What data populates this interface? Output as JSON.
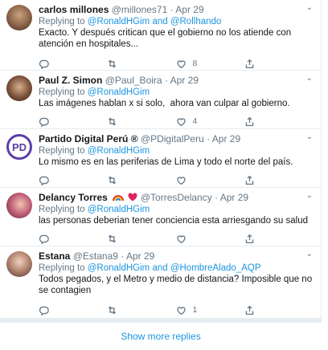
{
  "replies": [
    {
      "name": "carlos millones",
      "handle": "@millones71",
      "sep": "·",
      "date": "Apr 29",
      "replying_prefix": "Replying to",
      "replying_to": "@RonaldHGim and @Rollhando",
      "text": "Exacto. Y después critican que el gobierno no los atiende con atención en hospitales...",
      "reply_count": "",
      "retweet_count": "",
      "like_count": "8"
    },
    {
      "name": "Paul Z. Simon",
      "handle": "@Paul_Boira",
      "sep": "·",
      "date": "Apr 29",
      "replying_prefix": "Replying to",
      "replying_to": "@RonaldHGim",
      "text": "Las imágenes hablan x si solo,  ahora van culpar al gobierno.",
      "reply_count": "",
      "retweet_count": "",
      "like_count": "4"
    },
    {
      "name": "Partido Digital Perú",
      "badge": "®",
      "handle": "@PDigitalPeru",
      "sep": "·",
      "date": "Apr 29",
      "replying_prefix": "Replying to",
      "replying_to": "@RonaldHGim",
      "text": "Lo mismo es en las periferias de Lima y todo el norte del país.",
      "avatar_text": "PD",
      "reply_count": "",
      "retweet_count": "",
      "like_count": ""
    },
    {
      "name": "Delancy Torres",
      "handle": "@TorresDelancy",
      "sep": "·",
      "date": "Apr 29",
      "replying_prefix": "Replying to",
      "replying_to": "@RonaldHGim",
      "text": "las personas deberian tener conciencia esta arriesgando su salud",
      "reply_count": "",
      "retweet_count": "",
      "like_count": ""
    },
    {
      "name": "Estana",
      "handle": "@Estana9",
      "sep": "·",
      "date": "Apr 29",
      "replying_prefix": "Replying to",
      "replying_to": "@RonaldHGim and @HombreAlado_AQP",
      "text": "Todos pegados, y el Metro y medio de distancia? Imposible que no se contagien",
      "reply_count": "",
      "retweet_count": "",
      "like_count": "1"
    }
  ],
  "show_more": "Show more replies",
  "colors": {
    "link": "#1b95e0",
    "muted": "#657786",
    "text": "#14171a",
    "border": "#e6ecf0"
  },
  "icons": [
    "reply-icon",
    "retweet-icon",
    "like-icon",
    "share-icon",
    "chevron-down-icon",
    "rainbow-icon",
    "heart-emoji-icon"
  ]
}
